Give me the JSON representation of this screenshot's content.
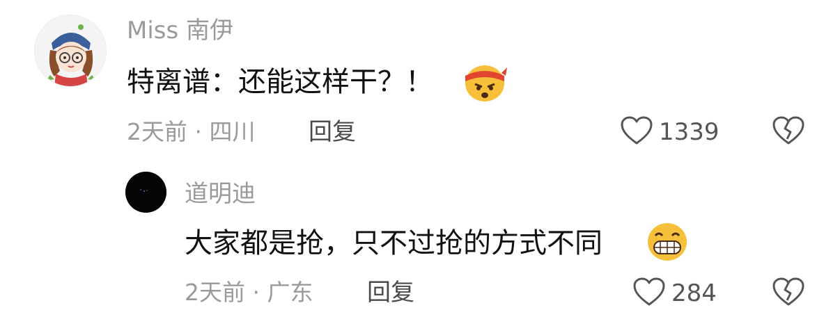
{
  "comment": {
    "username": "Miss 南伊",
    "text": "特离谱：还能这样干？！",
    "emoji_icon": "angry-headband-emoji-icon",
    "meta": "2天前 · 四川",
    "reply_label": "回复",
    "likes": "1339"
  },
  "reply": {
    "username": "道明迪",
    "text": "大家都是抢，只不过抢的方式不同",
    "emoji_icon": "grinning-teeth-emoji-icon",
    "meta": "2天前 · 广东",
    "reply_label": "回复",
    "likes": "284"
  }
}
